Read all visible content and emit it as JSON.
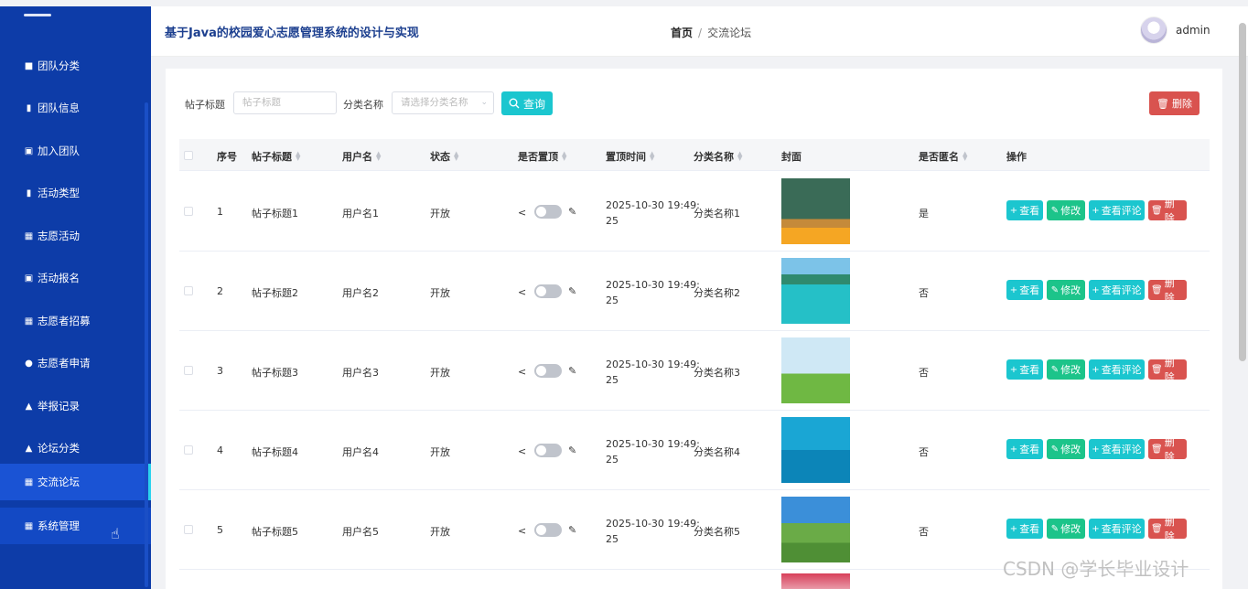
{
  "app": {
    "title": "基于Java的校园爱心志愿管理系统的设计与实现"
  },
  "breadcrumb": {
    "home": "首页",
    "separator": "/",
    "current": "交流论坛"
  },
  "user": {
    "name": "admin"
  },
  "sidebar": {
    "items": [
      {
        "label": "团队分类",
        "icon": "folder-icon"
      },
      {
        "label": "团队信息",
        "icon": "message-icon"
      },
      {
        "label": "加入团队",
        "icon": "clipboard-icon"
      },
      {
        "label": "活动类型",
        "icon": "bar-chart-icon"
      },
      {
        "label": "志愿活动",
        "icon": "grid-icon"
      },
      {
        "label": "活动报名",
        "icon": "clipboard-icon"
      },
      {
        "label": "志愿者招募",
        "icon": "grid-icon"
      },
      {
        "label": "志愿者申请",
        "icon": "bulb-icon"
      },
      {
        "label": "举报记录",
        "icon": "user-icon"
      },
      {
        "label": "论坛分类",
        "icon": "user-icon"
      },
      {
        "label": "交流论坛",
        "icon": "grid-icon",
        "active": true
      },
      {
        "label": "系统管理",
        "icon": "grid-icon"
      }
    ]
  },
  "search": {
    "title_label": "帖子标题",
    "title_placeholder": "帖子标题",
    "category_label": "分类名称",
    "category_placeholder": "请选择分类名称",
    "query_button": "查询",
    "delete_button": "删除"
  },
  "table": {
    "columns": [
      "序号",
      "帖子标题",
      "用户名",
      "状态",
      "是否置顶",
      "置顶时间",
      "分类名称",
      "封面",
      "是否匿名",
      "操作"
    ],
    "rows": [
      {
        "index": "1",
        "title": "帖子标题1",
        "username": "用户名1",
        "status": "开放",
        "time_line1": "2025-10-30 19:49:",
        "time_line2": "25",
        "category": "分类名称1",
        "anonymous": "是",
        "cover": "classroom"
      },
      {
        "index": "2",
        "title": "帖子标题2",
        "username": "用户名2",
        "status": "开放",
        "time_line1": "2025-10-30 19:49:",
        "time_line2": "25",
        "category": "分类名称2",
        "anonymous": "否",
        "cover": "resort"
      },
      {
        "index": "3",
        "title": "帖子标题3",
        "username": "用户名3",
        "status": "开放",
        "time_line1": "2025-10-30 19:49:",
        "time_line2": "25",
        "category": "分类名称3",
        "anonymous": "否",
        "cover": "field"
      },
      {
        "index": "4",
        "title": "帖子标题4",
        "username": "用户名4",
        "status": "开放",
        "time_line1": "2025-10-30 19:49:",
        "time_line2": "25",
        "category": "分类名称4",
        "anonymous": "否",
        "cover": "swim"
      },
      {
        "index": "5",
        "title": "帖子标题5",
        "username": "用户名5",
        "status": "开放",
        "time_line1": "2025-10-30 19:49:",
        "time_line2": "25",
        "category": "分类名称5",
        "anonymous": "否",
        "cover": "meadow"
      }
    ],
    "actions": {
      "view": "查看",
      "edit": "修改",
      "comments": "查看评论",
      "delete": "删除"
    }
  },
  "watermark": "CSDN @学长毕业设计",
  "colors": {
    "sidebar": "#0d3ca8",
    "sidebar_active": "#1a53d4",
    "accent_cyan": "#1bc6cf",
    "green": "#1cc48a",
    "danger": "#d9534f",
    "title_blue": "#1c3f8f"
  }
}
